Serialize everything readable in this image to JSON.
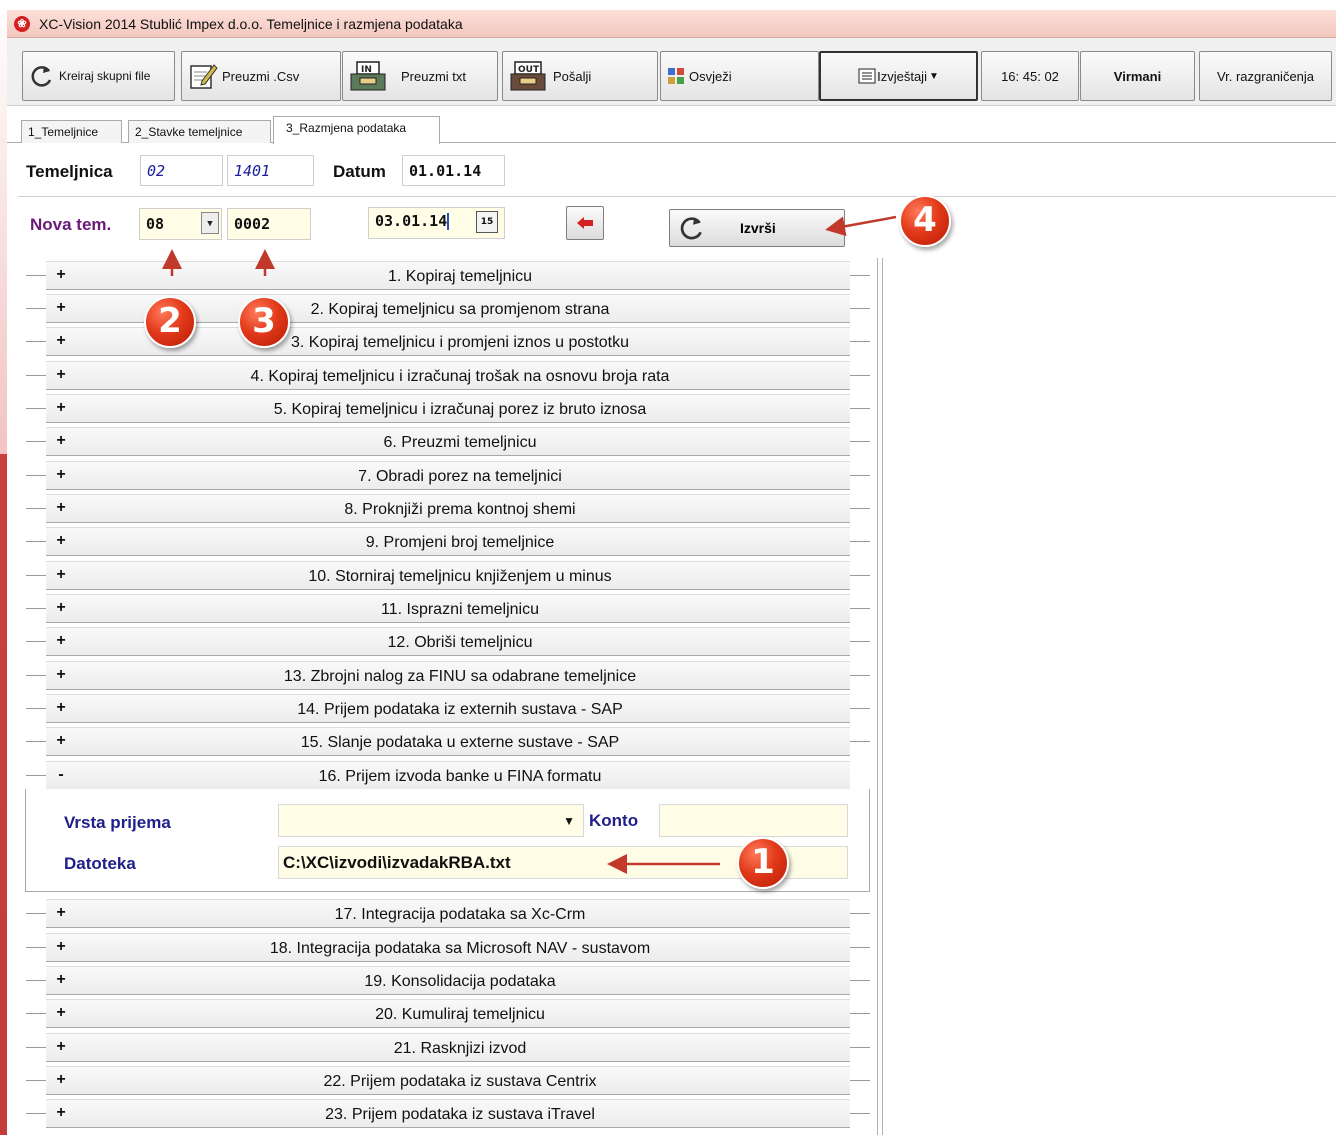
{
  "window": {
    "title": "XC-Vision 2014 Stublić Impex d.o.o. Temeljnice i razmjena podataka"
  },
  "toolbar": {
    "kreiraj_label": "Kreiraj skupni file",
    "preuzmi_csv_label": "Preuzmi .Csv",
    "preuzmi_txt_label": "Preuzmi  txt",
    "posalji_label": "Pošalji",
    "osvjezi_label": "Osvježi",
    "izvjestaji_label": "Izvještaji",
    "clock": "16: 45: 02",
    "virmani_label": "Virmani",
    "razgranicenja_label": "Vr. razgraničenja"
  },
  "tabs": [
    "1_Temeljnice",
    "2_Stavke temeljnice",
    "3_Razmjena podataka"
  ],
  "header": {
    "temeljnica_label": "Temeljnica",
    "temeljnica_code": "02",
    "temeljnica_number": "1401",
    "datum_label": "Datum",
    "datum_value": "01.01.14"
  },
  "nova": {
    "label": "Nova tem.",
    "code": "08",
    "number": "0002",
    "date": "03.01.14",
    "execute_label": "Izvrši"
  },
  "actions": [
    {
      "sign": "+",
      "label": "1.  Kopiraj temeljnicu"
    },
    {
      "sign": "+",
      "label": "2.  Kopiraj temeljnicu sa promjenom strana"
    },
    {
      "sign": "+",
      "label": "3.  Kopiraj temeljnicu i promjeni iznos u postotku"
    },
    {
      "sign": "+",
      "label": "4.  Kopiraj  temeljnicu i izračunaj trošak na osnovu broja rata"
    },
    {
      "sign": "+",
      "label": "5.  Kopiraj temeljnicu i izračunaj porez iz bruto iznosa"
    },
    {
      "sign": "+",
      "label": "6.  Preuzmi temeljnicu"
    },
    {
      "sign": "+",
      "label": "7.  Obradi porez na temeljnici"
    },
    {
      "sign": "+",
      "label": "8.  Proknjiži prema kontnoj shemi"
    },
    {
      "sign": "+",
      "label": "9.  Promjeni broj temeljnice"
    },
    {
      "sign": "+",
      "label": "10.  Storniraj temeljnicu knjiženjem u minus"
    },
    {
      "sign": "+",
      "label": "11.  Isprazni temeljnicu"
    },
    {
      "sign": "+",
      "label": "12.  Obriši temeljnicu"
    },
    {
      "sign": "+",
      "label": "13.  Zbrojni nalog za FINU sa odabrane temeljnice"
    },
    {
      "sign": "+",
      "label": "14.  Prijem podataka iz externih sustava - SAP"
    },
    {
      "sign": "+",
      "label": "15.  Slanje podataka u externe sustave - SAP"
    },
    {
      "sign": "-",
      "label": "16.  Prijem izvoda banke u FINA formatu"
    },
    {
      "sign": "+",
      "label": "17. Integracija podataka sa Xc-Crm"
    },
    {
      "sign": "+",
      "label": "18. Integracija podataka sa Microsoft NAV - sustavom"
    },
    {
      "sign": "+",
      "label": "19. Konsolidacija podataka"
    },
    {
      "sign": "+",
      "label": "20. Kumuliraj temeljnicu"
    },
    {
      "sign": "+",
      "label": "21. Rasknjizi izvod"
    },
    {
      "sign": "+",
      "label": "22. Prijem podataka iz sustava Centrix"
    },
    {
      "sign": "+",
      "label": "23. Prijem podataka iz sustava iTravel"
    }
  ],
  "panel16": {
    "vrsta_label": "Vrsta prijema",
    "vrsta_value": "",
    "konto_label": "Konto",
    "konto_value": "",
    "datoteka_label": "Datoteka",
    "datoteka_value": "C:\\XC\\izvodi\\izvadakRBA.txt"
  },
  "annotations": [
    "1",
    "2",
    "3",
    "4"
  ],
  "colors": {
    "accent_red": "#c0392b",
    "nova_label": "#6b1a7a",
    "panel_label": "#20208a",
    "field_yellow": "#fffde6"
  }
}
